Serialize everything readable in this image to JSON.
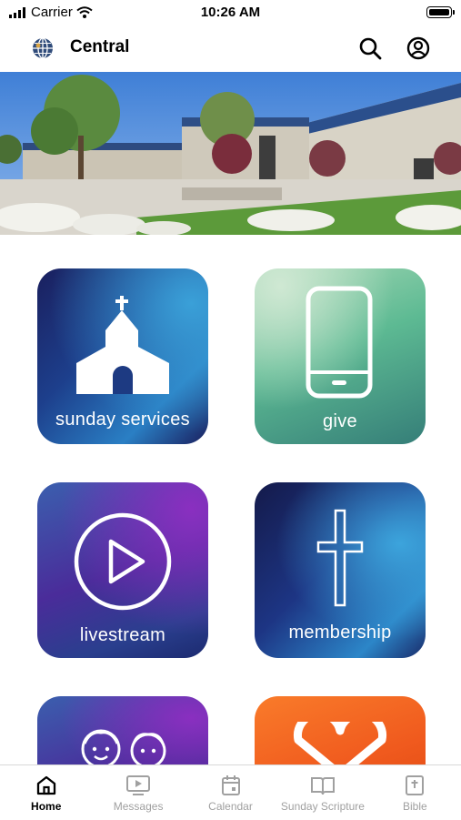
{
  "status_bar": {
    "carrier": "Carrier",
    "time": "10:26 AM"
  },
  "header": {
    "title": "Central",
    "search_icon": "search-icon",
    "profile_icon": "profile-icon"
  },
  "tiles": [
    {
      "label": "sunday services",
      "icon": "church-icon"
    },
    {
      "label": "give",
      "icon": "phone-icon"
    },
    {
      "label": "livestream",
      "icon": "play-icon"
    },
    {
      "label": "membership",
      "icon": "cross-icon"
    },
    {
      "label": "",
      "icon": "kids-icon"
    },
    {
      "label": "",
      "icon": "heart-icon"
    }
  ],
  "tabbar": {
    "active": "Home",
    "items": [
      {
        "label": "Home",
        "icon": "home-icon"
      },
      {
        "label": "Messages",
        "icon": "video-icon"
      },
      {
        "label": "Calendar",
        "icon": "calendar-icon"
      },
      {
        "label": "Sunday Scripture",
        "icon": "book-icon"
      },
      {
        "label": "Bible",
        "icon": "bible-icon"
      }
    ]
  },
  "colors": {
    "accent": "#000000",
    "tab_inactive": "#a0a0a0"
  }
}
